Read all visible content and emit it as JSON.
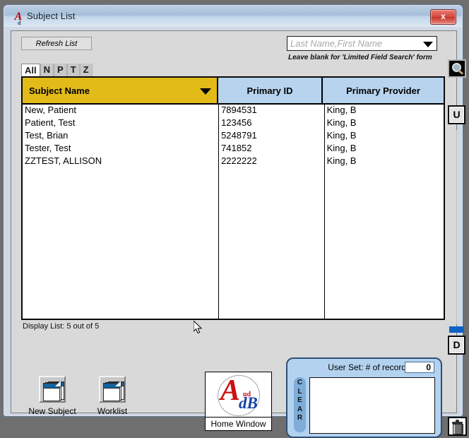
{
  "window": {
    "title": "Subject List",
    "app_icon": "audb-a-icon",
    "close_label": "x"
  },
  "toolbar": {
    "refresh_label": "Refresh List",
    "search_placeholder": "Last Name,First Name",
    "search_value": "",
    "search_icon": "magnifier-icon",
    "search_hint": "Leave blank for 'Limited Field Search' form",
    "combo_arrow_icon": "chevron-down-icon"
  },
  "letter_tabs": [
    {
      "label": "All",
      "active": true
    },
    {
      "label": "N",
      "active": false
    },
    {
      "label": "P",
      "active": false
    },
    {
      "label": "T",
      "active": false
    },
    {
      "label": "Z",
      "active": false
    }
  ],
  "grid": {
    "columns": [
      {
        "label": "Subject Name",
        "color": "#e3bb19",
        "sorted": true
      },
      {
        "label": "Primary ID",
        "color": "#b7d3ee",
        "sorted": false
      },
      {
        "label": "Primary Provider",
        "color": "#b7d3ee",
        "sorted": false
      }
    ],
    "sort_arrow_icon": "sort-descending-icon",
    "rows": [
      {
        "name": "New, Patient",
        "id": "7894531",
        "provider": "King, B"
      },
      {
        "name": "Patient, Test",
        "id": "123456",
        "provider": "King, B"
      },
      {
        "name": "Test, Brian",
        "id": "5248791",
        "provider": "King, B"
      },
      {
        "name": "Tester, Test",
        "id": "741852",
        "provider": "King, B"
      },
      {
        "name": "ZZTEST, ALLISON",
        "id": "2222222",
        "provider": "King, B"
      }
    ]
  },
  "scroll": {
    "up_label": "U",
    "down_label": "D"
  },
  "status": {
    "display_list": "Display List: 5 out of 5"
  },
  "actions": {
    "new_subject_label": "New Subject",
    "worklist_label": "Worklist",
    "note_icon": "note-stack-icon"
  },
  "home_window": {
    "label": "Home Window",
    "logo_a": "A",
    "logo_ud": "ud",
    "logo_db": "dB",
    "logo_name": "audb-logo-icon"
  },
  "user_set": {
    "title": "User Set:  # of records",
    "record_count": "0",
    "clear_label": "CLEAR",
    "list_items": []
  },
  "trash": {
    "icon": "trash-can-icon"
  },
  "cursor": {
    "icon": "mouse-pointer-icon"
  },
  "colors": {
    "sorted_header": "#e3bb19",
    "header": "#b7d3ee",
    "accent_blue": "#1063c6",
    "panel_blue": "#b3d2ef",
    "window_chrome": "#a6c0db",
    "logo_red": "#cc1111",
    "logo_blue": "#1540a8"
  }
}
